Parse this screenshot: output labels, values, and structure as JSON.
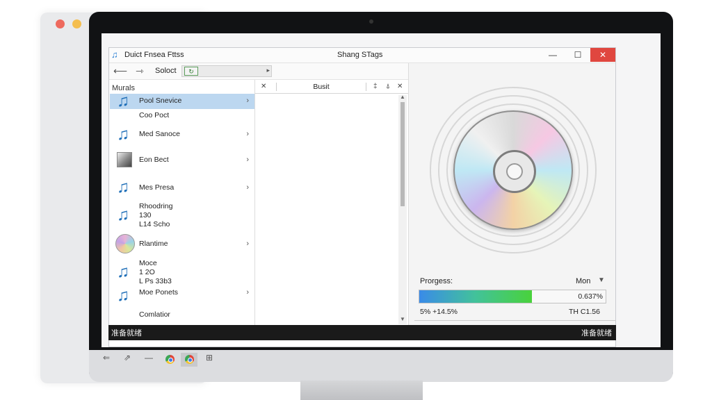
{
  "window": {
    "app_title": "Duict Fnsea Fttss",
    "title": "Shang STags",
    "minimize": "—",
    "maximize": "☐",
    "close": "✕"
  },
  "toolbar": {
    "back": "⟵",
    "forward": "⇾",
    "select_label": "Soloct",
    "path_icon": "↻",
    "path_arrow": "▸"
  },
  "left_pane": {
    "header": "Murals",
    "items": [
      {
        "label": "Pool Snevice",
        "icon": "music-note-icon",
        "selected": true,
        "chevron": "›"
      },
      {
        "label": "Coo Poct",
        "icon": "none",
        "selected": false,
        "chevron": ""
      },
      {
        "label": "Med Sanoce",
        "icon": "music-note-icon",
        "selected": false,
        "chevron": "›"
      },
      {
        "label": "Eon Bect",
        "icon": "photo-icon",
        "selected": false,
        "chevron": "›"
      },
      {
        "label": "Mes Presa",
        "icon": "music-note-icon",
        "selected": false,
        "chevron": "›"
      },
      {
        "label": "Rhoodring\n130\nL14 Scho",
        "icon": "music-note-icon",
        "selected": false,
        "chevron": ""
      },
      {
        "label": "Rlantime",
        "icon": "disc-icon",
        "selected": false,
        "chevron": "›"
      },
      {
        "label": "Moce\n1 2O\nL Ps 33b3",
        "icon": "music-note-icon",
        "selected": false,
        "chevron": ""
      },
      {
        "label": "Moe Ponets",
        "icon": "music-note-icon",
        "selected": false,
        "chevron": "›"
      },
      {
        "label": "Comlatior",
        "icon": "none",
        "selected": false,
        "chevron": ""
      }
    ]
  },
  "mid_pane": {
    "close_glyph": "✕",
    "column": "Busit",
    "icon_sort": "‡",
    "icon_pin": "⍋",
    "icon_close": "✕",
    "scroll_up": "▲",
    "scroll_down": "▼"
  },
  "right_pane": {
    "progress_label": "Prorgess:",
    "mode": "Mon",
    "mode_caret": "▼",
    "progress_value": 0.6037,
    "progress_pct": "0.637%",
    "stat_left": "5%  +14.5%",
    "stat_right": "TH C1.56",
    "footer_close": "✕"
  },
  "status": {
    "left": "准备就绪",
    "right": "准备就绪"
  },
  "taskbar": {
    "back": "⇐",
    "forward": "⇗",
    "dash": "—",
    "grid": "⊞"
  },
  "colors": {
    "selection": "#bcd7f0",
    "close_button": "#e0473f",
    "progress_start": "#3a8be8",
    "progress_end": "#49d23b",
    "status_bar": "#1a1a1a"
  }
}
